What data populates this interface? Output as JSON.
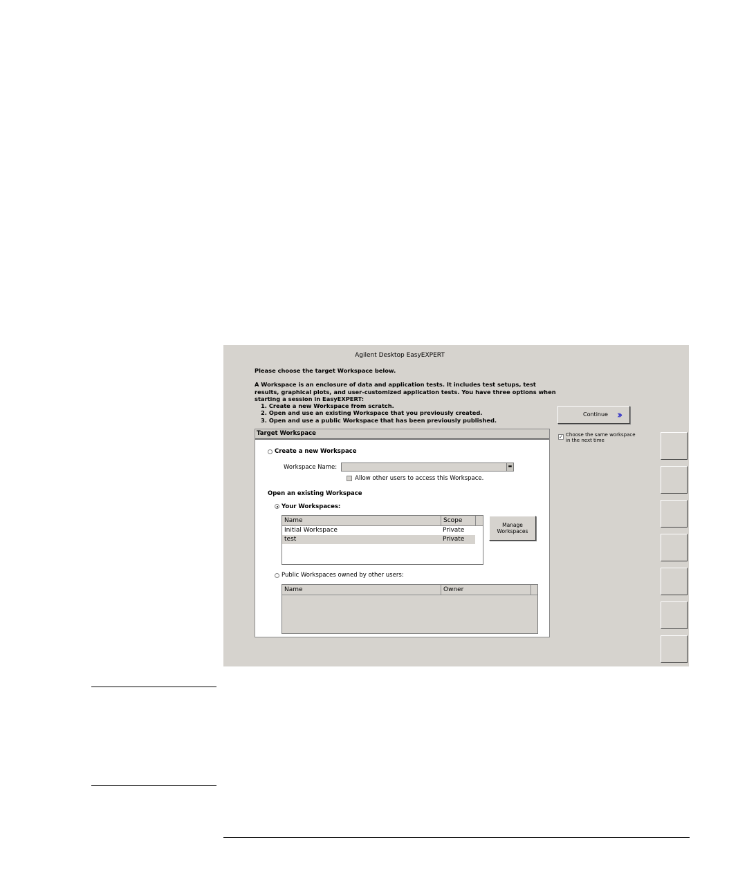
{
  "app": {
    "title": "Agilent Desktop EasyEXPERT"
  },
  "intro": {
    "heading": "Please choose the target Workspace below.",
    "para_line1": "A Workspace is an enclosure of data and application tests. It includes test setups, test",
    "para_line2": "results, graphical plots, and user-customized application tests. You have three options when",
    "para_line3": "starting a session in EasyEXPERT:",
    "option1": "1. Create a new Workspace from scratch.",
    "option2": "2. Open and use an existing Workspace that you previously created.",
    "option3": "3. Open and use a public Workspace that has been previously published."
  },
  "continue_button": {
    "label": "Continue",
    "icon": "double-chevron-right-icon",
    "accent": "#3b3bc8"
  },
  "remember_checkbox": {
    "checked": true,
    "line1": "Choose the same workspace",
    "line2": "in the next time"
  },
  "target_panel": {
    "header": "Target Workspace",
    "create_new": {
      "label": "Create a new Workspace",
      "selected": false,
      "name_label": "Workspace Name:",
      "name_value": "",
      "allow_label": "Allow other users to access this Workspace.",
      "allow_checked": false
    },
    "open_existing_label": "Open an existing Workspace",
    "your_workspaces": {
      "label": "Your Workspaces:",
      "selected": true,
      "columns": [
        "Name",
        "Scope"
      ],
      "rows": [
        {
          "name": "Initial Workspace",
          "scope": "Private",
          "selected": false
        },
        {
          "name": "test",
          "scope": "Private",
          "selected": true
        }
      ],
      "manage_line1": "Manage",
      "manage_line2": "Workspaces"
    },
    "public_workspaces": {
      "label": "Public Workspaces owned by other users:",
      "selected": false,
      "columns": [
        "Name",
        "Owner"
      ],
      "rows": []
    }
  }
}
